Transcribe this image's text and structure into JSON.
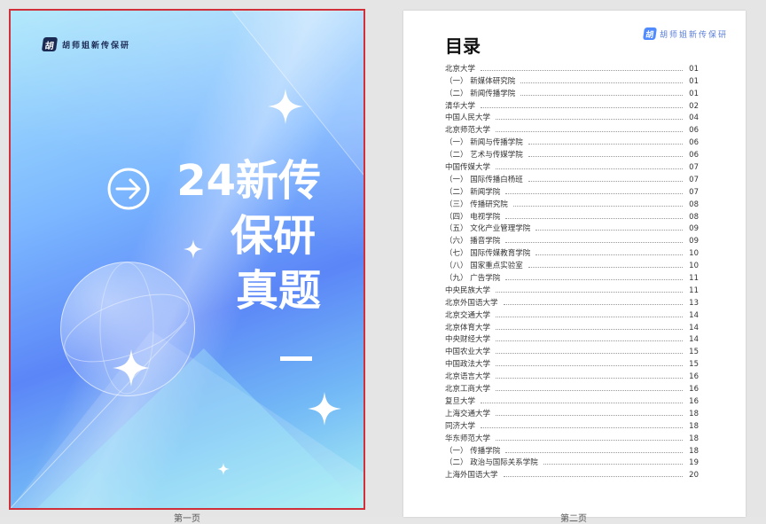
{
  "cover": {
    "logo_mark": "胡",
    "logo_text": "胡师姐新传保研",
    "title_line1": "24新传",
    "title_line2": "保研",
    "title_line3": "真题",
    "page_label": "第一页"
  },
  "toc": {
    "logo_mark": "胡",
    "logo_text": "胡师姐新传保研",
    "heading": "目录",
    "page_label": "第二页",
    "entries": [
      {
        "label": "北京大学",
        "page": "01"
      },
      {
        "label": "（一） 新媒体研究院",
        "page": "01"
      },
      {
        "label": "（二） 新闻传播学院",
        "page": "01"
      },
      {
        "label": "清华大学",
        "page": "02"
      },
      {
        "label": "中国人民大学",
        "page": "04"
      },
      {
        "label": "北京师范大学",
        "page": "06"
      },
      {
        "label": "（一） 新闻与传播学院",
        "page": "06"
      },
      {
        "label": "（二） 艺术与传媒学院",
        "page": "06"
      },
      {
        "label": "中国传媒大学",
        "page": "07"
      },
      {
        "label": "（一） 国际传播白杨班",
        "page": "07"
      },
      {
        "label": "（二） 新闻学院",
        "page": "07"
      },
      {
        "label": "（三） 传播研究院",
        "page": "08"
      },
      {
        "label": "（四） 电视学院",
        "page": "08"
      },
      {
        "label": "（五） 文化产业管理学院",
        "page": "09"
      },
      {
        "label": "（六） 播音学院",
        "page": "09"
      },
      {
        "label": "（七） 国际传媒教育学院",
        "page": "10"
      },
      {
        "label": "（八） 国家重点实验室",
        "page": "10"
      },
      {
        "label": "（九） 广告学院",
        "page": "11"
      },
      {
        "label": "中央民族大学",
        "page": "11"
      },
      {
        "label": "北京外国语大学",
        "page": "13"
      },
      {
        "label": "北京交通大学",
        "page": "14"
      },
      {
        "label": "北京体育大学",
        "page": "14"
      },
      {
        "label": "中央财经大学",
        "page": "14"
      },
      {
        "label": "中国农业大学",
        "page": "15"
      },
      {
        "label": "中国政法大学",
        "page": "15"
      },
      {
        "label": "北京语言大学",
        "page": "16"
      },
      {
        "label": "北京工商大学",
        "page": "16"
      },
      {
        "label": "复旦大学",
        "page": "16"
      },
      {
        "label": "上海交通大学",
        "page": "18"
      },
      {
        "label": "同济大学",
        "page": "18"
      },
      {
        "label": "华东师范大学",
        "page": "18"
      },
      {
        "label": "（一） 传播学院",
        "page": "18"
      },
      {
        "label": "（二） 政治与国际关系学院",
        "page": "19"
      },
      {
        "label": "上海外国语大学",
        "page": "20"
      }
    ]
  },
  "colors": {
    "cover_border": "#d0303a",
    "accent_blue": "#5b86f7",
    "toc_text": "#333333"
  },
  "icons": {
    "arrow": "arrow-right-circle-icon",
    "star": "sparkle-star-icon",
    "globe": "globe-icon"
  }
}
